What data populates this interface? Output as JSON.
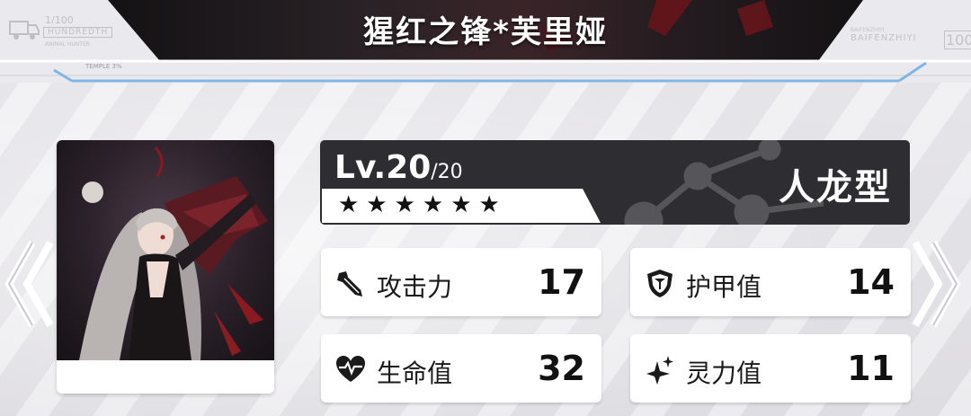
{
  "header": {
    "title": "猩红之锋*芙里娅",
    "counter": "1/100",
    "counter_word": "HUNDREDTH",
    "counter_sub": "ANIMAL HUNTER",
    "small_tag": "TEMPLE 3%",
    "brand_small": "BAIFENZHIYI",
    "brand": "BAIFENZHIYI",
    "brand_num": "100"
  },
  "character": {
    "level": "Lv.20",
    "level_max": "/20",
    "stars": "★★★★★★",
    "type": "人龙型"
  },
  "stats": {
    "attack": {
      "label": "攻击力",
      "value": "17"
    },
    "armor": {
      "label": "护甲值",
      "value": "14"
    },
    "hp": {
      "label": "生命值",
      "value": "32"
    },
    "spirit": {
      "label": "灵力值",
      "value": "11"
    }
  },
  "icons": {
    "attack": "drill-icon",
    "armor": "shield-icon",
    "hp": "heart-pulse-icon",
    "spirit": "sparkle-icon",
    "prev": "double-chevron-left-icon",
    "next": "double-chevron-right-icon"
  },
  "colors": {
    "panel_dark": "#2e2e32",
    "header_dark": "#1c1a1e",
    "accent_red": "#8a1a1f",
    "header_line": "#7fb6e6"
  }
}
